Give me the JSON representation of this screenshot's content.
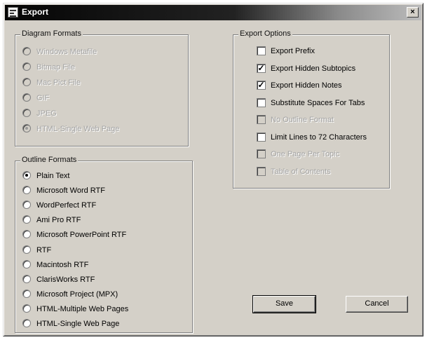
{
  "window": {
    "title": "Export",
    "close_glyph": "×",
    "icon": "app-icon"
  },
  "diagram_formats": {
    "legend": "Diagram Formats",
    "options": [
      {
        "label": "Windows Metafile",
        "selected": false
      },
      {
        "label": "Bitmap File",
        "selected": false
      },
      {
        "label": "Mac Pict File",
        "selected": false
      },
      {
        "label": "GIF",
        "selected": false
      },
      {
        "label": "JPEG",
        "selected": false
      },
      {
        "label": "HTML-Single Web Page",
        "selected": true
      }
    ]
  },
  "outline_formats": {
    "legend": "Outline Formats",
    "options": [
      {
        "label": "Plain Text",
        "selected": true
      },
      {
        "label": "Microsoft Word RTF",
        "selected": false
      },
      {
        "label": "WordPerfect RTF",
        "selected": false
      },
      {
        "label": "Ami Pro RTF",
        "selected": false
      },
      {
        "label": "Microsoft PowerPoint RTF",
        "selected": false
      },
      {
        "label": "RTF",
        "selected": false
      },
      {
        "label": "Macintosh RTF",
        "selected": false
      },
      {
        "label": "ClarisWorks RTF",
        "selected": false
      },
      {
        "label": "Microsoft Project (MPX)",
        "selected": false
      },
      {
        "label": "HTML-Multiple Web Pages",
        "selected": false
      },
      {
        "label": "HTML-Single Web Page",
        "selected": false
      }
    ]
  },
  "export_options": {
    "legend": "Export Options",
    "options": [
      {
        "label": "Export Prefix",
        "checked": false,
        "enabled": true
      },
      {
        "label": "Export Hidden Subtopics",
        "checked": true,
        "enabled": true
      },
      {
        "label": "Export Hidden Notes",
        "checked": true,
        "enabled": true
      },
      {
        "label": "Substitute Spaces For Tabs",
        "checked": false,
        "enabled": true
      },
      {
        "label": "No Outline Format",
        "checked": false,
        "enabled": false
      },
      {
        "label": "Limit Lines to 72 Characters",
        "checked": false,
        "enabled": true
      },
      {
        "label": "One Page Per Topic",
        "checked": false,
        "enabled": false
      },
      {
        "label": "Table of Contents",
        "checked": false,
        "enabled": false
      }
    ]
  },
  "buttons": {
    "save": "Save",
    "cancel": "Cancel"
  },
  "check_glyph": "✓"
}
